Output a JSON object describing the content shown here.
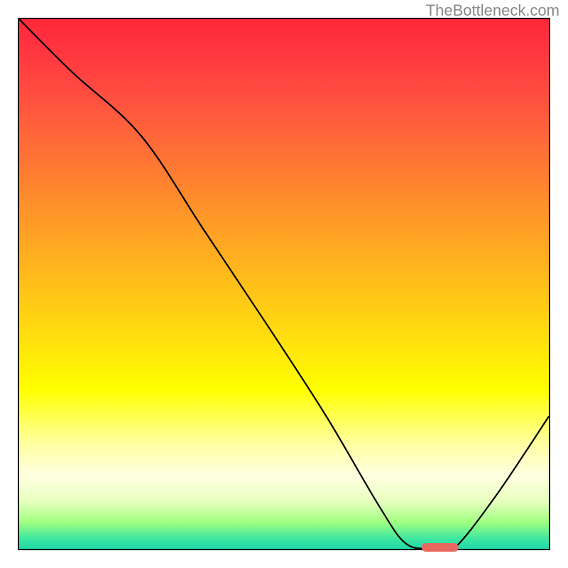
{
  "watermark": "TheBottleneck.com",
  "chart_data": {
    "type": "line",
    "title": "",
    "xlabel": "",
    "ylabel": "",
    "xlim": [
      0,
      100
    ],
    "ylim": [
      0,
      100
    ],
    "grid": false,
    "background": "red-yellow-green vertical gradient",
    "series": [
      {
        "name": "bottleneck-curve",
        "color": "#000000",
        "x": [
          0,
          10,
          23,
          35,
          47,
          58,
          68,
          73,
          78,
          82,
          90,
          100
        ],
        "y": [
          100,
          90,
          78,
          60,
          42,
          25,
          8,
          1,
          0,
          0,
          10,
          25
        ]
      }
    ],
    "marker": {
      "x_center": 79,
      "width_pct": 7,
      "y": 0.8,
      "color": "#e86860"
    }
  }
}
